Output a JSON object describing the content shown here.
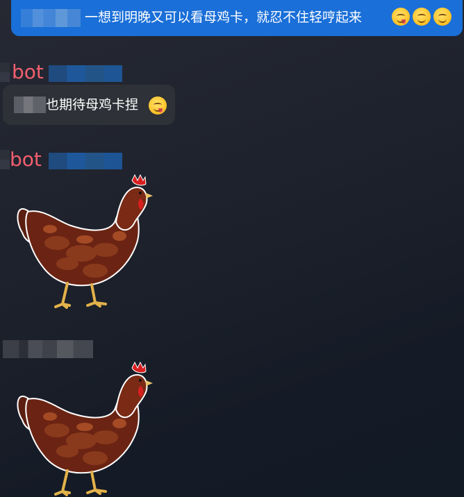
{
  "messages": [
    {
      "direction": "outgoing",
      "text": "一想到明晚又可以看母鸡卡，就忍不住轻哼起来",
      "emojis": [
        "yum-face",
        "smile-face",
        "smile-face"
      ]
    },
    {
      "direction": "incoming",
      "sender": "bot",
      "text": "也期待母鸡卡捏",
      "emojis": [
        "yum-face"
      ]
    },
    {
      "direction": "incoming",
      "sender": "bot",
      "sticker": "chicken-sticker"
    },
    {
      "direction": "incoming",
      "sticker": "chicken-sticker"
    }
  ],
  "colors": {
    "outgoing_bubble": "#1a6fd8",
    "incoming_bubble": "#2e3137",
    "sender_name": "#f25f6f",
    "background": "#1d212b"
  }
}
